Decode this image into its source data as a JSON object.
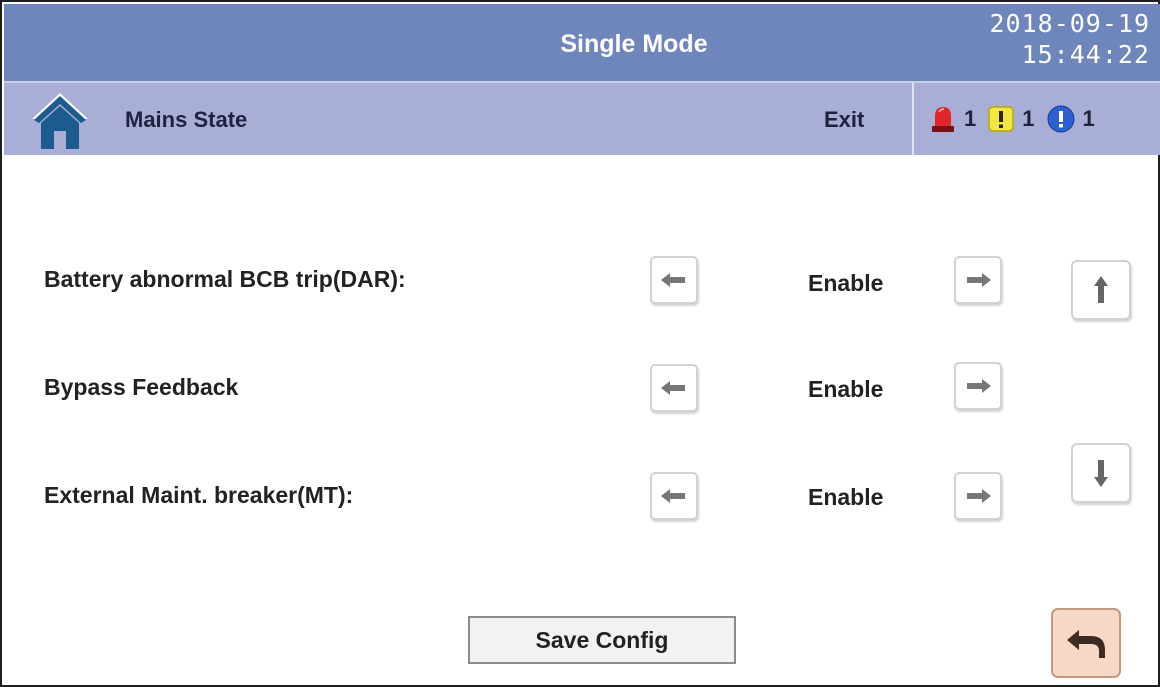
{
  "header": {
    "title": "Single Mode",
    "date": "2018-09-19",
    "time": "15:44:22"
  },
  "nav": {
    "home_icon": "home-icon",
    "page_title": "Mains State",
    "exit_label": "Exit",
    "alarms": [
      {
        "icon": "siren-icon",
        "count": "1",
        "color": "#e0262a"
      },
      {
        "icon": "warning-icon",
        "count": "1",
        "color": "#f2e640"
      },
      {
        "icon": "info-icon",
        "count": "1",
        "color": "#2a5fd6"
      }
    ]
  },
  "settings": [
    {
      "label": "Battery abnormal BCB trip(DAR):",
      "value": "Enable"
    },
    {
      "label": "Bypass Feedback",
      "value": "Enable"
    },
    {
      "label": "External Maint. breaker(MT):",
      "value": "Enable"
    }
  ],
  "buttons": {
    "save_label": "Save Config",
    "scroll_up_icon": "arrow-up-icon",
    "scroll_down_icon": "arrow-down-icon",
    "back_icon": "return-icon"
  },
  "colors": {
    "title_bar": "#6f86bd",
    "nav_bar": "#a8aed6",
    "home_icon": "#1b5b8e",
    "back_button": "#f5d8c6"
  }
}
